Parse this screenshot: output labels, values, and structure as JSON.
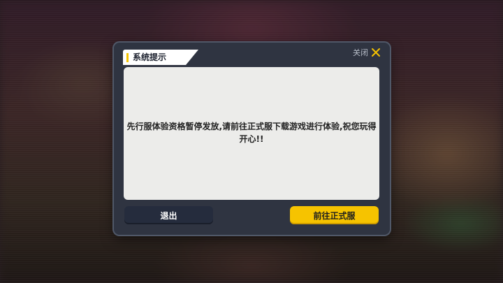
{
  "dialog": {
    "title": "系统提示",
    "close_label": "关闭",
    "message": "先行服体验资格暂停发放,请前往正式服下载游戏进行体验,祝您玩得开心!!",
    "exit_button": "退出",
    "confirm_button": "前往正式服"
  },
  "colors": {
    "accent": "#f6c300",
    "dialog_bg": "#2f3441",
    "panel_bg": "#ececea",
    "exit_button_bg": "#252c3d"
  },
  "icons": {
    "close": "close-x-icon"
  }
}
